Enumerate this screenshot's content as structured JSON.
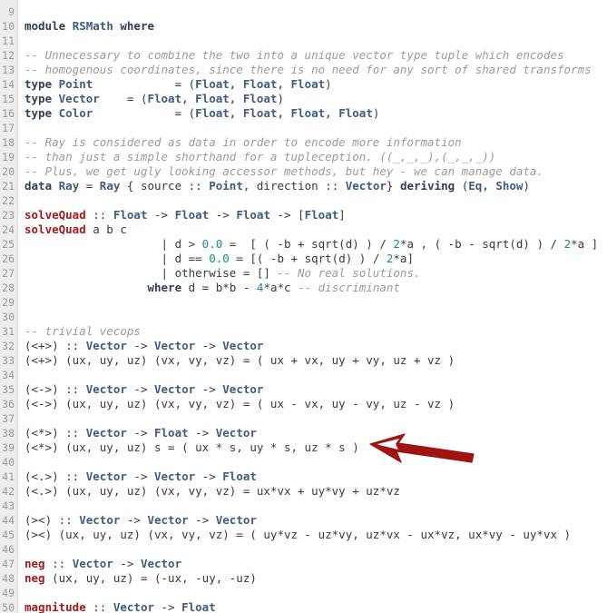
{
  "editor": {
    "language": "Haskell",
    "module_name": "RSMath",
    "gutter_first_line": 9,
    "gutter_last_line": 50,
    "colors": {
      "background": "#ffffff",
      "gutter_background": "#ededed",
      "gutter_text": "#9a9a9a",
      "keyword": "#2f3e52",
      "function": "#a01b1b",
      "type": "#3f5c80",
      "comment": "#9b9b9b",
      "number": "#1c8b8b",
      "plain": "#3a3a3a",
      "arrow": "#a01313"
    }
  },
  "annotation": {
    "arrow_name": "red-left-arrow",
    "points_at_line": 39,
    "points_at_text": "(<*>) (ux, uy, uz) s = ( ux * s, uy * s, uz * s )"
  },
  "lines": [
    {
      "num": 9,
      "tokens": []
    },
    {
      "num": 10,
      "tokens": [
        {
          "t": "module ",
          "c": "kw"
        },
        {
          "t": "RSMath ",
          "c": "type"
        },
        {
          "t": "where",
          "c": "kw"
        }
      ]
    },
    {
      "num": 11,
      "tokens": []
    },
    {
      "num": 12,
      "tokens": [
        {
          "t": "-- Unnecessary to combine the two into a unique vector type tuple which encodes",
          "c": "comment"
        }
      ]
    },
    {
      "num": 13,
      "tokens": [
        {
          "t": "-- homogenous coordinates, since there is no need for any sort of shared transforms",
          "c": "comment"
        }
      ]
    },
    {
      "num": 14,
      "tokens": [
        {
          "t": "type ",
          "c": "kw"
        },
        {
          "t": "Point",
          "c": "type"
        },
        {
          "t": "            = (",
          "c": "plain"
        },
        {
          "t": "Float, Float, Float",
          "c": "type"
        },
        {
          "t": ")",
          "c": "plain"
        }
      ]
    },
    {
      "num": 15,
      "tokens": [
        {
          "t": "type ",
          "c": "kw"
        },
        {
          "t": "Vector",
          "c": "type"
        },
        {
          "t": "    = (",
          "c": "plain"
        },
        {
          "t": "Float, Float, Float",
          "c": "type"
        },
        {
          "t": ")",
          "c": "plain"
        }
      ]
    },
    {
      "num": 16,
      "tokens": [
        {
          "t": "type ",
          "c": "kw"
        },
        {
          "t": "Color",
          "c": "type"
        },
        {
          "t": "            = (",
          "c": "plain"
        },
        {
          "t": "Float, Float, Float, Float",
          "c": "type"
        },
        {
          "t": ")",
          "c": "plain"
        }
      ]
    },
    {
      "num": 17,
      "tokens": []
    },
    {
      "num": 18,
      "tokens": [
        {
          "t": "-- Ray is considered as data in order to encode more information",
          "c": "comment"
        }
      ]
    },
    {
      "num": 19,
      "tokens": [
        {
          "t": "-- than just a simple shorthand for a tupleception. ((_,_,_),(_,_,_))",
          "c": "comment"
        }
      ]
    },
    {
      "num": 20,
      "tokens": [
        {
          "t": "-- Plus, we get ugly looking accessor methods, but hey - we can manage data.",
          "c": "comment"
        }
      ]
    },
    {
      "num": 21,
      "tokens": [
        {
          "t": "data ",
          "c": "kw"
        },
        {
          "t": "Ray",
          "c": "type"
        },
        {
          "t": " = ",
          "c": "plain"
        },
        {
          "t": "Ray",
          "c": "type"
        },
        {
          "t": " { source :: ",
          "c": "plain"
        },
        {
          "t": "Point",
          "c": "type"
        },
        {
          "t": ", direction :: ",
          "c": "plain"
        },
        {
          "t": "Vector",
          "c": "type"
        },
        {
          "t": "} ",
          "c": "plain"
        },
        {
          "t": "deriving ",
          "c": "kw"
        },
        {
          "t": "(",
          "c": "plain"
        },
        {
          "t": "Eq, Show",
          "c": "type"
        },
        {
          "t": ")",
          "c": "plain"
        }
      ]
    },
    {
      "num": 22,
      "tokens": []
    },
    {
      "num": 23,
      "tokens": [
        {
          "t": "solveQuad",
          "c": "fn"
        },
        {
          "t": " :: ",
          "c": "plain"
        },
        {
          "t": "Float",
          "c": "type"
        },
        {
          "t": " -> ",
          "c": "plain"
        },
        {
          "t": "Float",
          "c": "type"
        },
        {
          "t": " -> ",
          "c": "plain"
        },
        {
          "t": "Float",
          "c": "type"
        },
        {
          "t": " -> [",
          "c": "plain"
        },
        {
          "t": "Float",
          "c": "type"
        },
        {
          "t": "]",
          "c": "plain"
        }
      ]
    },
    {
      "num": 24,
      "tokens": [
        {
          "t": "solveQuad",
          "c": "fn"
        },
        {
          "t": " a b c",
          "c": "plain"
        }
      ]
    },
    {
      "num": 25,
      "tokens": [
        {
          "t": "                    | d > ",
          "c": "plain"
        },
        {
          "t": "0.0",
          "c": "num"
        },
        {
          "t": " =  [ ( -b + sqrt(d) ) / ",
          "c": "plain"
        },
        {
          "t": "2",
          "c": "num"
        },
        {
          "t": "*a , ( -b - sqrt(d) ) / ",
          "c": "plain"
        },
        {
          "t": "2",
          "c": "num"
        },
        {
          "t": "*a ]",
          "c": "plain"
        }
      ]
    },
    {
      "num": 26,
      "tokens": [
        {
          "t": "                    | d == ",
          "c": "plain"
        },
        {
          "t": "0.0",
          "c": "num"
        },
        {
          "t": " = [( -b + sqrt(d) ) / ",
          "c": "plain"
        },
        {
          "t": "2",
          "c": "num"
        },
        {
          "t": "*a]",
          "c": "plain"
        }
      ]
    },
    {
      "num": 27,
      "tokens": [
        {
          "t": "                    | otherwise = [] ",
          "c": "plain"
        },
        {
          "t": "-- No real solutions.",
          "c": "comment"
        }
      ]
    },
    {
      "num": 28,
      "tokens": [
        {
          "t": "                  ",
          "c": "plain"
        },
        {
          "t": "where",
          "c": "kw"
        },
        {
          "t": " d = b*b - ",
          "c": "plain"
        },
        {
          "t": "4",
          "c": "num"
        },
        {
          "t": "*a*c ",
          "c": "plain"
        },
        {
          "t": "-- discriminant",
          "c": "comment"
        }
      ]
    },
    {
      "num": 29,
      "tokens": []
    },
    {
      "num": 30,
      "tokens": []
    },
    {
      "num": 31,
      "tokens": [
        {
          "t": "-- trivial vecops",
          "c": "comment"
        }
      ]
    },
    {
      "num": 32,
      "tokens": [
        {
          "t": "(<+>) :: ",
          "c": "plain"
        },
        {
          "t": "Vector",
          "c": "type"
        },
        {
          "t": " -> ",
          "c": "plain"
        },
        {
          "t": "Vector",
          "c": "type"
        },
        {
          "t": " -> ",
          "c": "plain"
        },
        {
          "t": "Vector",
          "c": "type"
        }
      ]
    },
    {
      "num": 33,
      "tokens": [
        {
          "t": "(<+>) (ux, uy, uz) (vx, vy, vz) = ( ux + vx, uy + vy, uz + vz )",
          "c": "plain"
        }
      ]
    },
    {
      "num": 34,
      "tokens": []
    },
    {
      "num": 35,
      "tokens": [
        {
          "t": "(<->) :: ",
          "c": "plain"
        },
        {
          "t": "Vector",
          "c": "type"
        },
        {
          "t": " -> ",
          "c": "plain"
        },
        {
          "t": "Vector",
          "c": "type"
        },
        {
          "t": " -> ",
          "c": "plain"
        },
        {
          "t": "Vector",
          "c": "type"
        }
      ]
    },
    {
      "num": 36,
      "tokens": [
        {
          "t": "(<->) (ux, uy, uz) (vx, vy, vz) = ( ux - vx, uy - vy, uz - vz )",
          "c": "plain"
        }
      ]
    },
    {
      "num": 37,
      "tokens": []
    },
    {
      "num": 38,
      "tokens": [
        {
          "t": "(<*>) :: ",
          "c": "plain"
        },
        {
          "t": "Vector",
          "c": "type"
        },
        {
          "t": " -> ",
          "c": "plain"
        },
        {
          "t": "Float",
          "c": "type"
        },
        {
          "t": " -> ",
          "c": "plain"
        },
        {
          "t": "Vector",
          "c": "type"
        }
      ]
    },
    {
      "num": 39,
      "tokens": [
        {
          "t": "(<*>) (ux, uy, uz) s = ( ux * s, uy * s, uz * s )",
          "c": "plain"
        }
      ]
    },
    {
      "num": 40,
      "tokens": []
    },
    {
      "num": 41,
      "tokens": [
        {
          "t": "(<.>) :: ",
          "c": "plain"
        },
        {
          "t": "Vector",
          "c": "type"
        },
        {
          "t": " -> ",
          "c": "plain"
        },
        {
          "t": "Vector",
          "c": "type"
        },
        {
          "t": " -> ",
          "c": "plain"
        },
        {
          "t": "Float",
          "c": "type"
        }
      ]
    },
    {
      "num": 42,
      "tokens": [
        {
          "t": "(<.>) (ux, uy, uz) (vx, vy, vz) = ux*vx + uy*vy + uz*vz",
          "c": "plain"
        }
      ]
    },
    {
      "num": 43,
      "tokens": []
    },
    {
      "num": 44,
      "tokens": [
        {
          "t": "(><) :: ",
          "c": "plain"
        },
        {
          "t": "Vector",
          "c": "type"
        },
        {
          "t": " -> ",
          "c": "plain"
        },
        {
          "t": "Vector",
          "c": "type"
        },
        {
          "t": " -> ",
          "c": "plain"
        },
        {
          "t": "Vector",
          "c": "type"
        }
      ]
    },
    {
      "num": 45,
      "tokens": [
        {
          "t": "(><) (ux, uy, uz) (vx, vy, vz) = ( uy*vz - uz*vy, uz*vx - ux*vz, ux*vy - uy*vx )",
          "c": "plain"
        }
      ]
    },
    {
      "num": 46,
      "tokens": []
    },
    {
      "num": 47,
      "tokens": [
        {
          "t": "neg",
          "c": "fn"
        },
        {
          "t": " :: ",
          "c": "plain"
        },
        {
          "t": "Vector",
          "c": "type"
        },
        {
          "t": " -> ",
          "c": "plain"
        },
        {
          "t": "Vector",
          "c": "type"
        }
      ]
    },
    {
      "num": 48,
      "tokens": [
        {
          "t": "neg",
          "c": "fn"
        },
        {
          "t": " (ux, uy, uz) = (-ux, -uy, -uz)",
          "c": "plain"
        }
      ]
    },
    {
      "num": 49,
      "tokens": []
    },
    {
      "num": 50,
      "tokens": [
        {
          "t": "magnitude",
          "c": "fn"
        },
        {
          "t": " :: ",
          "c": "plain"
        },
        {
          "t": "Vector",
          "c": "type"
        },
        {
          "t": " -> ",
          "c": "plain"
        },
        {
          "t": "Float",
          "c": "type"
        }
      ]
    }
  ]
}
